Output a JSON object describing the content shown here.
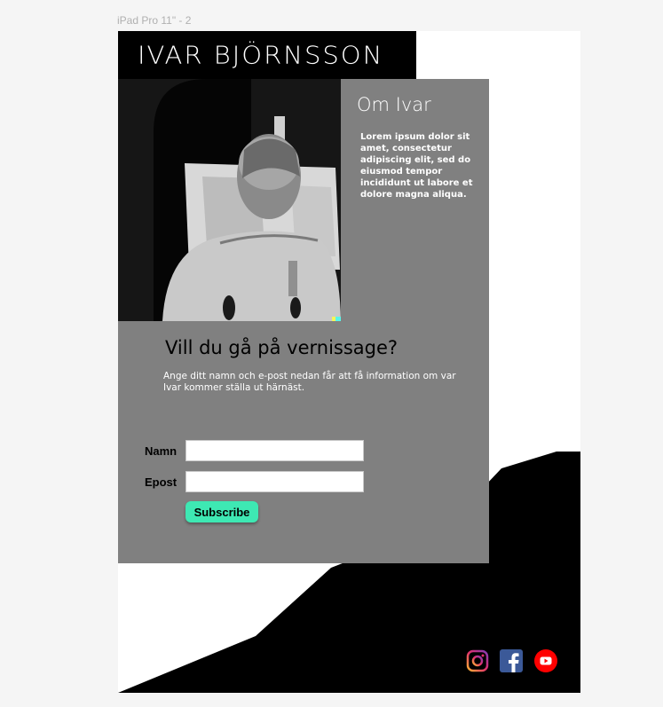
{
  "frame_label": "iPad Pro 11\" - 2",
  "header": {
    "title": "IVAR BJÖRNSSON"
  },
  "about": {
    "title": "Om Ivar",
    "text": "Lorem ipsum dolor sit amet, consectetur adipiscing elit, sed do eiusmod tempor incididunt ut labore et dolore magna aliqua."
  },
  "vernissage": {
    "title": "Vill du gå på vernissage?",
    "text": "Ange ditt namn och e-post nedan får att få information om var Ivar kommer ställa ut härnäst."
  },
  "form": {
    "name_label": "Namn",
    "name_value": "",
    "email_label": "Epost",
    "email_value": "",
    "submit_label": "Subscribe"
  },
  "social": [
    {
      "name": "instagram-icon",
      "colors": [
        "#f9b233",
        "#e1306c",
        "#833ab4"
      ]
    },
    {
      "name": "facebook-icon",
      "color": "#3b5998"
    },
    {
      "name": "youtube-icon",
      "color": "#ff0000"
    }
  ],
  "colors": {
    "panel": "#808080",
    "accent": "#3ee8b3",
    "header": "#000000"
  }
}
